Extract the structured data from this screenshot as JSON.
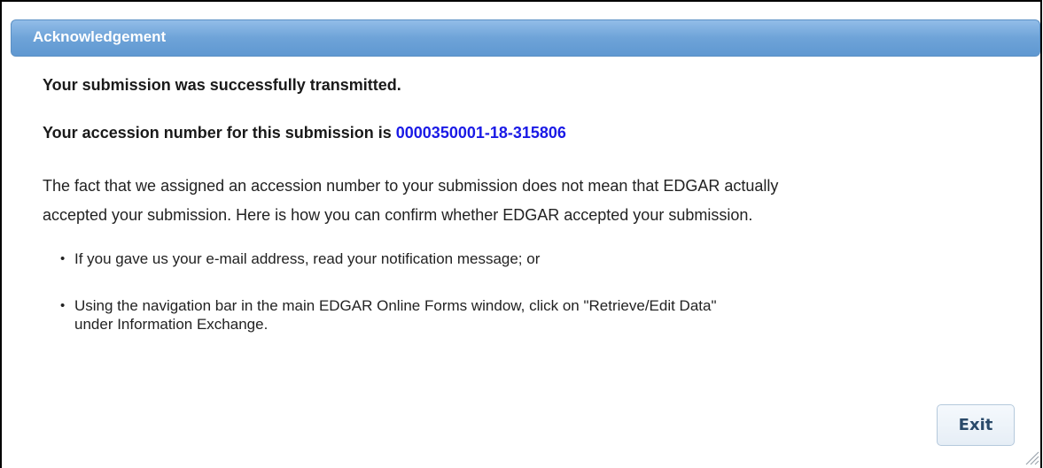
{
  "dialog": {
    "title": "Acknowledgement"
  },
  "content": {
    "heading": "Your submission was successfully transmitted.",
    "accession_prefix": "Your accession number for this submission is ",
    "accession_number": "0000350001-18-315806",
    "paragraph_line1": "The fact that we assigned an accession number to your submission does not mean that EDGAR actually",
    "paragraph_line2": "accepted your submission. Here is how you can confirm whether EDGAR accepted your submission.",
    "bullets": [
      {
        "dot": "•",
        "text": "If you gave us your e-mail address, read your notification message; or"
      },
      {
        "dot": "•",
        "text_line1": "Using the navigation bar in the main EDGAR Online Forms window, click on \"Retrieve/Edit Data\"",
        "text_line2": "under Information Exchange."
      }
    ]
  },
  "buttons": {
    "exit_label": "Exit"
  },
  "colors": {
    "header_blue": "#6ea3d8",
    "accession_blue": "#1a1ae6"
  },
  "icons": {
    "resize": "resize-grip-icon"
  }
}
